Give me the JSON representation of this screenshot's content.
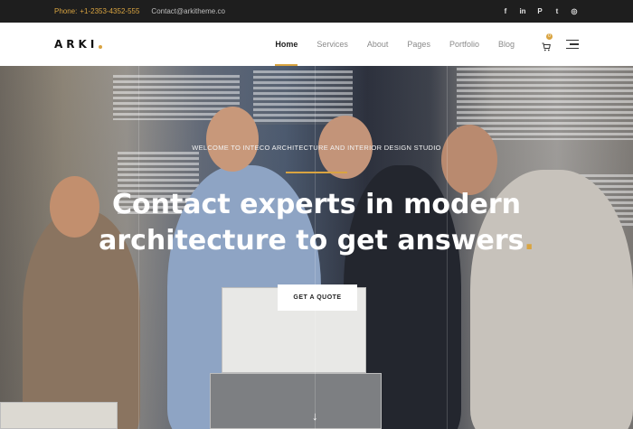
{
  "topbar": {
    "phone_label": "Phone:",
    "phone": "+1-2353-4352-555",
    "email": "Contact@arkitheme.co",
    "socials": [
      "facebook-icon",
      "linkedin-icon",
      "pinterest-icon",
      "twitter-icon",
      "instagram-icon"
    ],
    "social_glyphs": [
      "f",
      "in",
      "P",
      "t",
      "◎"
    ]
  },
  "nav": {
    "logo": "ARKI",
    "items": [
      "Home",
      "Services",
      "About",
      "Pages",
      "Portfolio",
      "Blog"
    ],
    "active": "Home",
    "cart_count": "0"
  },
  "hero": {
    "subtitle": "WELCOME TO INTECO ARCHITECTURE AND INTERIOR DESIGN STUDIO",
    "title_line1": "Contact experts in modern",
    "title_line2": "architecture to get answers",
    "title_dot": ".",
    "cta": "GET A QUOTE"
  },
  "colors": {
    "accent": "#d9a441",
    "topbar_bg": "#1e1e1e"
  }
}
